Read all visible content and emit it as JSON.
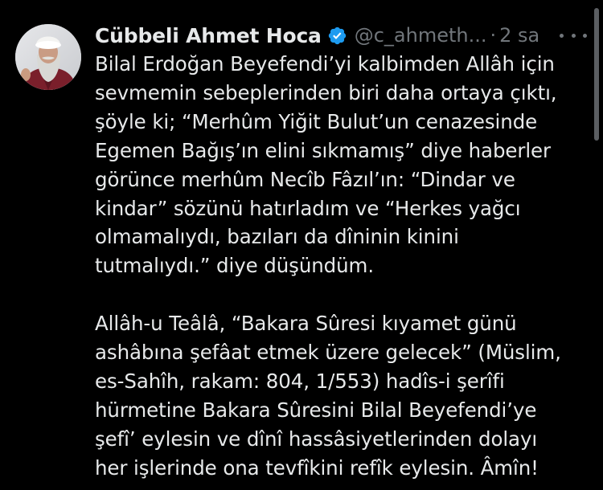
{
  "tweet": {
    "author": {
      "display_name": "Cübbeli Ahmet Hoca",
      "handle": "@c_ahmeth...",
      "verified": true,
      "avatar_icon": "profile-photo"
    },
    "separator": "·",
    "time": "2 sa",
    "more_icon": "more-horizontal-icon",
    "paragraph1": [
      "Bilal Erdoğan Beyefendi’yi kalbimden Allâh için",
      "sevmemin sebeplerinden biri daha ortaya çıktı,",
      "şöyle ki; “Merhûm Yiğit Bulut’un cenazesinde",
      "Egemen Bağış’ın elini sıkmamış” diye haberler",
      "görünce merhûm Necîb Fâzıl’ın: “Dindar ve",
      "kindar” sözünü hatırladım ve “Herkes yağcı",
      "olmamalıydı, bazıları da dîninin kinini",
      "tutmalıydı.” diye düşündüm."
    ],
    "paragraph2": [
      "Allâh-u Teâlâ, “Bakara Sûresi kıyamet günü",
      "ashâbına şefâat etmek üzere gelecek” (Müslim,",
      "es-Sahîh, rakam: 804, 1/553) hadîs-i şerîfi",
      "hürmetine Bakara Sûresini Bilal Beyefendi’ye",
      "şefî’ eylesin ve dînî hassâsiyetlerinden dolayı",
      "her işlerinde ona tevfîkini refîk eylesin. Âmîn!"
    ]
  },
  "colors": {
    "background": "#000000",
    "text": "#e7e9ea",
    "muted": "#71767b",
    "verified_blue": "#1d9bf0"
  }
}
